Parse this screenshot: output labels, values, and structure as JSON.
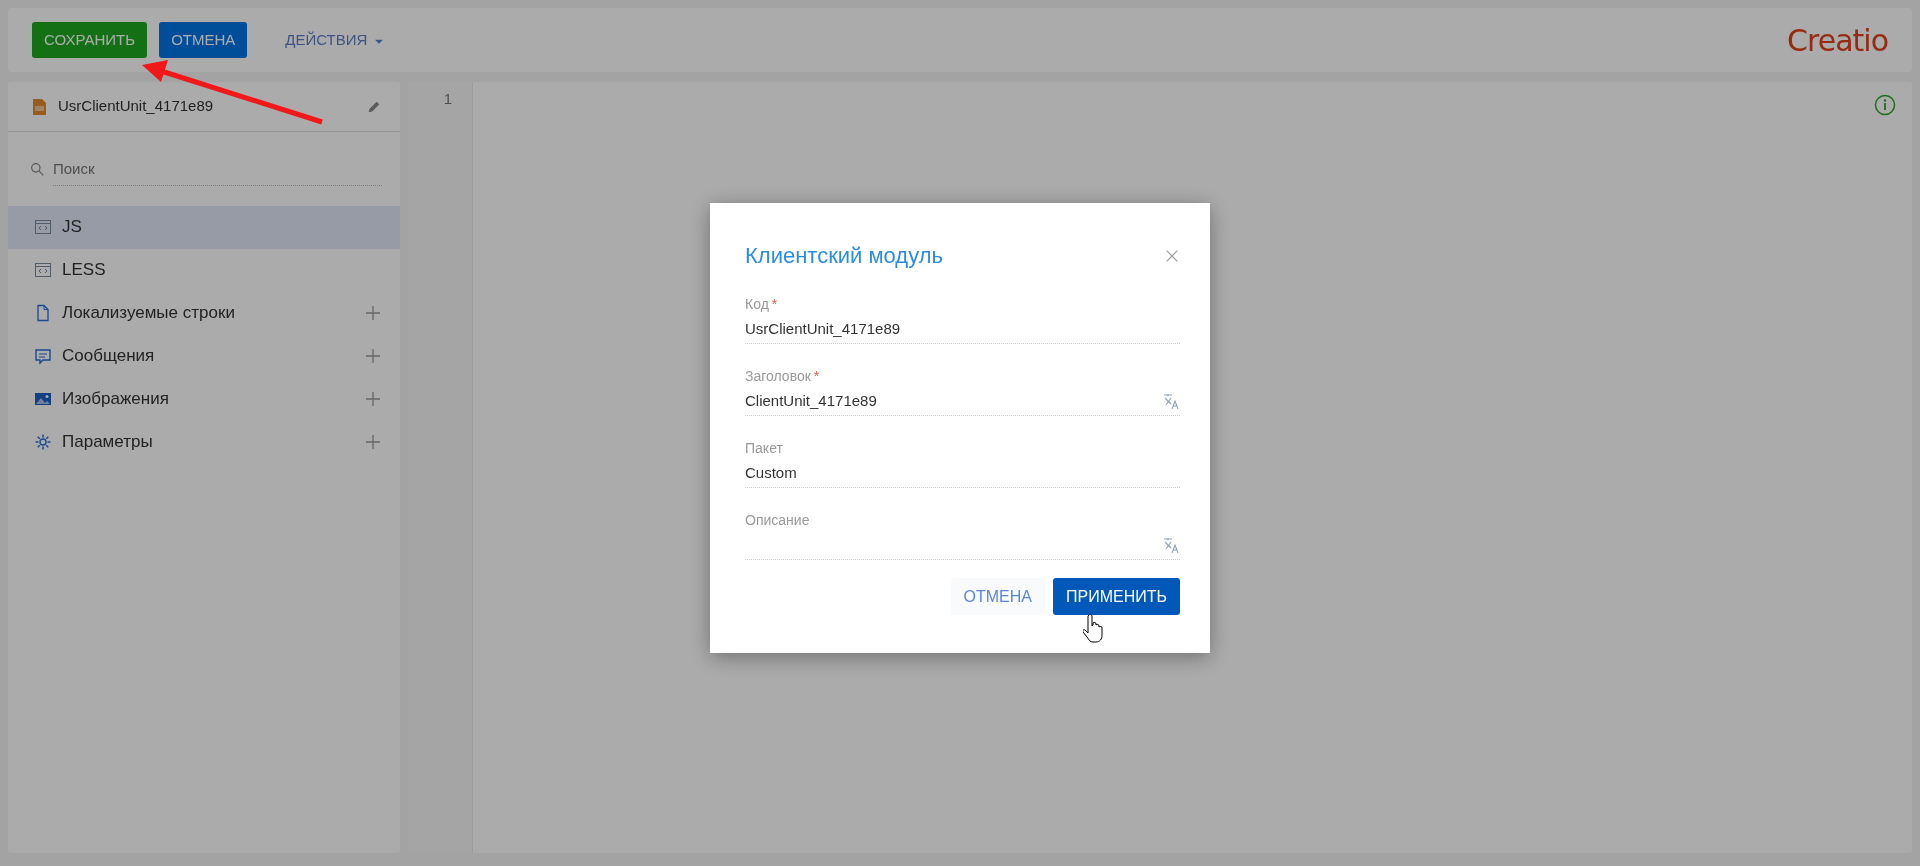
{
  "toolbar": {
    "buttons": [
      {
        "label": "СОХРАНИТЬ",
        "kind": "save"
      },
      {
        "label": "ОТМЕНА",
        "kind": "cancel"
      },
      {
        "label": "ДЕЙСТВИЯ",
        "kind": "menu"
      }
    ],
    "logo": "Creatio"
  },
  "sidebar": {
    "title": "UsrClientUnit_4171e89",
    "search": {
      "placeholder": "Поиск"
    },
    "items": [
      {
        "label": "JS",
        "kind": "code",
        "selected": true,
        "addable": false
      },
      {
        "label": "LESS",
        "kind": "code",
        "selected": false,
        "addable": false
      },
      {
        "label": "Локализуемые строки",
        "kind": "strings",
        "selected": false,
        "addable": true
      },
      {
        "label": "Сообщения",
        "kind": "messages",
        "selected": false,
        "addable": true
      },
      {
        "label": "Изображения",
        "kind": "images",
        "selected": false,
        "addable": true
      },
      {
        "label": "Параметры",
        "kind": "parameters",
        "selected": false,
        "addable": true
      }
    ]
  },
  "editor": {
    "line_numbers": [
      "1"
    ]
  },
  "dialog": {
    "title": "Клиентский модуль",
    "fields": [
      {
        "label": "Код",
        "required_mark": "*",
        "value": "UsrClientUnit_4171e89",
        "translatable": false
      },
      {
        "label": "Заголовок",
        "required_mark": "*",
        "value": "ClientUnit_4171e89",
        "translatable": true
      },
      {
        "label": "Пакет",
        "value": "Custom",
        "translatable": false
      },
      {
        "label": "Описание",
        "translatable": true
      }
    ],
    "buttons": [
      {
        "label": "ОТМЕНА",
        "kind": "cancel"
      },
      {
        "label": "ПРИМЕНИТЬ",
        "kind": "apply"
      }
    ]
  }
}
